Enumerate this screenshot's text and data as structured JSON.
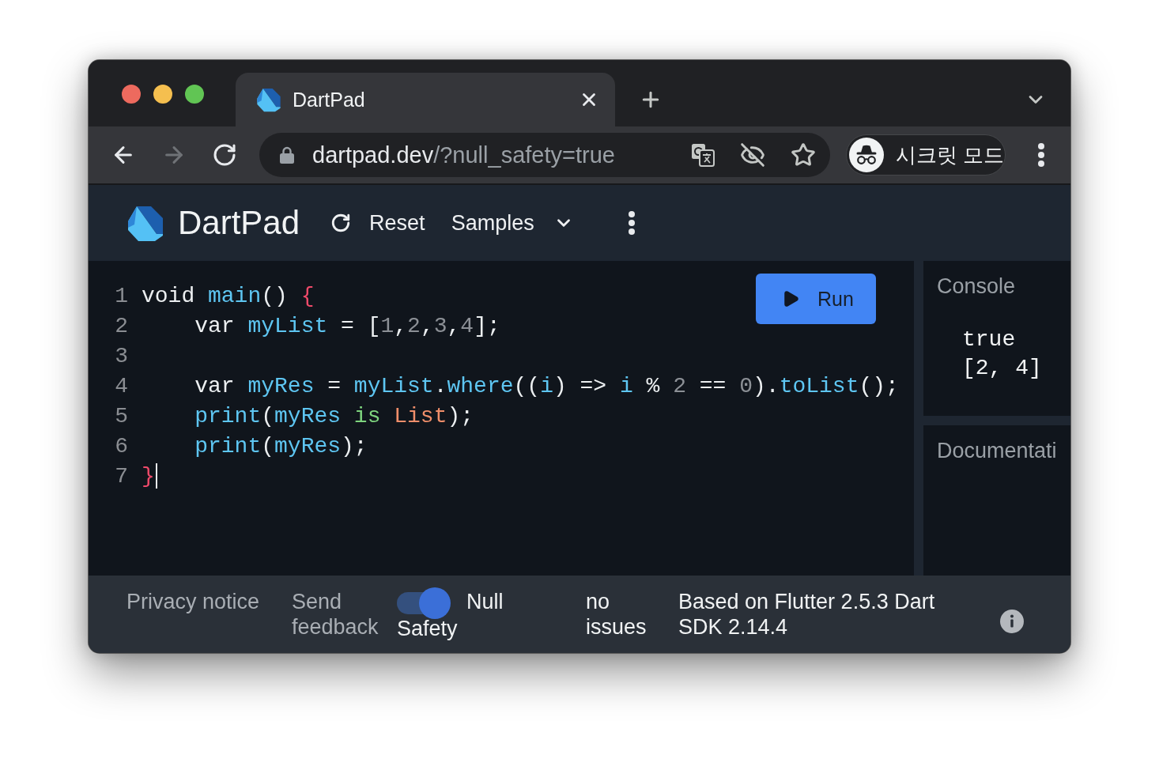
{
  "browser": {
    "tabs": [
      {
        "title": "DartPad",
        "selected": true
      }
    ],
    "nav_buttons": [
      {
        "kind": "back",
        "disabled": false
      },
      {
        "kind": "forward",
        "disabled": true
      },
      {
        "kind": "reload",
        "disabled": false
      }
    ],
    "address": {
      "host": "dartpad.dev",
      "path": "/?null_safety=true"
    },
    "profile": {
      "label": "시크릿 모드"
    }
  },
  "app": {
    "title": "DartPad",
    "actions": [
      {
        "kind": "reset",
        "label": "Reset"
      },
      {
        "kind": "samples",
        "label": "Samples"
      }
    ]
  },
  "editor": {
    "run_button": "Run",
    "lines": [
      {
        "number": "1",
        "indent": false,
        "cursor": false,
        "tokens": [
          {
            "text": "void ",
            "kind": "plain"
          },
          {
            "text": "main",
            "kind": "name"
          },
          {
            "text": "() ",
            "kind": "plain"
          },
          {
            "text": "{",
            "kind": "brace"
          }
        ]
      },
      {
        "number": "2",
        "indent": true,
        "cursor": false,
        "tokens": [
          {
            "text": "var ",
            "kind": "plain"
          },
          {
            "text": "myList",
            "kind": "name"
          },
          {
            "text": " = [",
            "kind": "plain"
          },
          {
            "text": "1",
            "kind": "number"
          },
          {
            "text": ",",
            "kind": "plain"
          },
          {
            "text": "2",
            "kind": "number"
          },
          {
            "text": ",",
            "kind": "plain"
          },
          {
            "text": "3",
            "kind": "number"
          },
          {
            "text": ",",
            "kind": "plain"
          },
          {
            "text": "4",
            "kind": "number"
          },
          {
            "text": "];",
            "kind": "plain"
          }
        ]
      },
      {
        "number": "3",
        "cursor": false
      },
      {
        "number": "4",
        "indent": true,
        "cursor": false,
        "tokens": [
          {
            "text": "var ",
            "kind": "plain"
          },
          {
            "text": "myRes",
            "kind": "name"
          },
          {
            "text": " = ",
            "kind": "plain"
          },
          {
            "text": "myList",
            "kind": "name"
          },
          {
            "text": ".",
            "kind": "plain"
          },
          {
            "text": "where",
            "kind": "name"
          },
          {
            "text": "((",
            "kind": "plain"
          },
          {
            "text": "i",
            "kind": "name"
          },
          {
            "text": ") => ",
            "kind": "plain"
          },
          {
            "text": "i",
            "kind": "name"
          },
          {
            "text": " % ",
            "kind": "plain"
          },
          {
            "text": "2",
            "kind": "number"
          },
          {
            "text": " == ",
            "kind": "plain"
          },
          {
            "text": "0",
            "kind": "number"
          },
          {
            "text": ").",
            "kind": "plain"
          },
          {
            "text": "toList",
            "kind": "name"
          },
          {
            "text": "();",
            "kind": "plain"
          }
        ]
      },
      {
        "number": "5",
        "indent": true,
        "cursor": false,
        "tokens": [
          {
            "text": "print",
            "kind": "name"
          },
          {
            "text": "(",
            "kind": "plain"
          },
          {
            "text": "myRes",
            "kind": "name"
          },
          {
            "text": " is ",
            "kind": "keyword"
          },
          {
            "text": "List",
            "kind": "type"
          },
          {
            "text": ");",
            "kind": "plain"
          }
        ]
      },
      {
        "number": "6",
        "indent": true,
        "cursor": false,
        "tokens": [
          {
            "text": "print",
            "kind": "name"
          },
          {
            "text": "(",
            "kind": "plain"
          },
          {
            "text": "myRes",
            "kind": "name"
          },
          {
            "text": ");",
            "kind": "plain"
          }
        ]
      },
      {
        "number": "7",
        "indent": false,
        "cursor": true,
        "tokens": [
          {
            "text": "}",
            "kind": "brace"
          }
        ]
      }
    ]
  },
  "console": {
    "title": "Console",
    "output": [
      "true",
      "[2, 4]"
    ]
  },
  "documentation": {
    "title": "Documentati"
  },
  "footer": {
    "links": [
      "Privacy notice",
      "Send feedback"
    ],
    "null_safety": {
      "label": "Null Safety",
      "on": true
    },
    "status": "no issues",
    "version": "Based on Flutter 2.5.3 Dart SDK 2.14.4"
  }
}
